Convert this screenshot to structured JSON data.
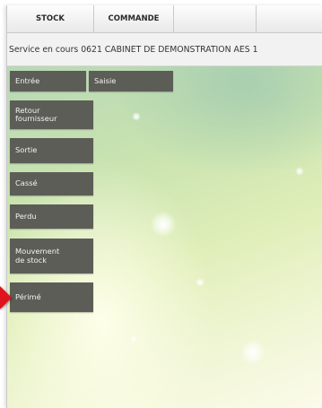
{
  "tabs": [
    {
      "label": "STOCK"
    },
    {
      "label": "COMMANDE"
    },
    {
      "label": ""
    },
    {
      "label": ""
    }
  ],
  "service_line": "Service en cours 0621 CABINET DE DEMONSTRATION AES 1",
  "menu": {
    "entree": "Entrée",
    "saisie": "Saisie",
    "retour_fournisseur": "Retour fournisseur",
    "sortie": "Sortie",
    "casse": "Cassé",
    "perdu": "Perdu",
    "mouvement_stock": "Mouvement de stock",
    "perime": "Périmé"
  },
  "colors": {
    "button_bg": "#5d5d58",
    "button_text": "#f2f2f2",
    "pointer": "#e0141c"
  },
  "icons": {
    "pointer": "red-arrow-pointer-icon"
  }
}
